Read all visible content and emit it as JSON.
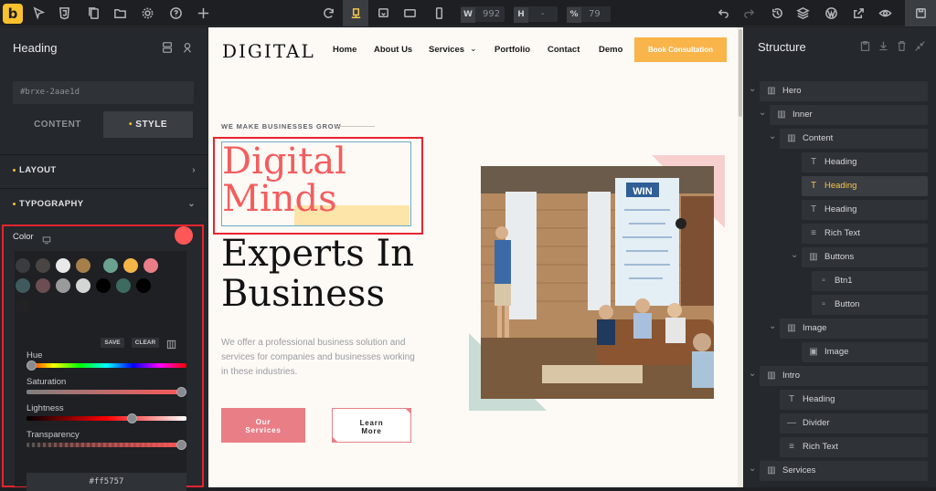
{
  "toolbar": {
    "logo": "b",
    "width_label": "W",
    "width_value": "992",
    "height_label": "H",
    "height_value": "-",
    "zoom_label": "%",
    "zoom_value": "79"
  },
  "left_panel": {
    "title": "Heading",
    "element_id": "#brxe-2aae1d",
    "tabs": [
      "CONTENT",
      "STYLE"
    ],
    "sections": [
      "LAYOUT",
      "TYPOGRAPHY"
    ],
    "color_label": "Color",
    "color_value": "#ff5757",
    "swatches_row1": [
      "#3a3d40",
      "#4a4442",
      "#e9e9e9",
      "#a77f4a",
      "#6aa28f",
      "#f4b547",
      "#e97e87"
    ],
    "swatches_row2": [
      "#3f5a5c",
      "#6b4d52",
      "#9a9a9a",
      "#d5d5d5",
      "#000000",
      "#3d6b5e",
      "#000000"
    ],
    "swatches_row3": [
      "#222222"
    ],
    "save_label": "SAVE",
    "clear_label": "CLEAR",
    "hue_label": "Hue",
    "saturation_label": "Saturation",
    "lightness_label": "Lightness",
    "transparency_label": "Transparency",
    "hue_level": 0,
    "saturation_level": 1.0,
    "lightness_level": 0.67,
    "transparency_level": 1.0,
    "hex_value": "#ff5757"
  },
  "canvas": {
    "logo": "DIGITAL",
    "nav": [
      "Home",
      "About Us",
      "Services",
      "Portfolio",
      "Contact",
      "Demo"
    ],
    "cta": "Book Consultation",
    "eyebrow": "WE MAKE BUSINESSES GROW",
    "heading_pink_1": "Digital",
    "heading_pink_2": "Minds",
    "heading_black_1": "Experts In",
    "heading_black_2": "Business",
    "paragraph": "We offer a professional business solution and services for companies and businesses working in these industries.",
    "btn_primary_1": "Our",
    "btn_primary_2": "Services",
    "btn_secondary_1": "Learn",
    "btn_secondary_2": "More",
    "win_sign": "WIN",
    "colors": {
      "accent": "#f45d5d",
      "button": "#e97e87",
      "cta": "#f9b44a"
    }
  },
  "structure": {
    "title": "Structure",
    "tree": [
      {
        "label": "Hero",
        "icon": "section-icon"
      },
      {
        "label": "Inner",
        "icon": "container-icon"
      },
      {
        "label": "Content",
        "icon": "container-icon"
      },
      {
        "label": "Heading",
        "icon": "heading-icon"
      },
      {
        "label": "Heading",
        "icon": "heading-icon",
        "selected": true
      },
      {
        "label": "Heading",
        "icon": "heading-icon"
      },
      {
        "label": "Rich Text",
        "icon": "rich-text-icon"
      },
      {
        "label": "Buttons",
        "icon": "container-icon"
      },
      {
        "label": "Btn1",
        "icon": "block-icon"
      },
      {
        "label": "Button",
        "icon": "block-icon"
      },
      {
        "label": "Image",
        "icon": "container-icon"
      },
      {
        "label": "Image",
        "icon": "image-icon"
      },
      {
        "label": "Intro",
        "icon": "section-icon"
      },
      {
        "label": "Heading",
        "icon": "heading-icon"
      },
      {
        "label": "Divider",
        "icon": "divider-icon"
      },
      {
        "label": "Rich Text",
        "icon": "rich-text-icon"
      },
      {
        "label": "Services",
        "icon": "section-icon"
      }
    ]
  }
}
